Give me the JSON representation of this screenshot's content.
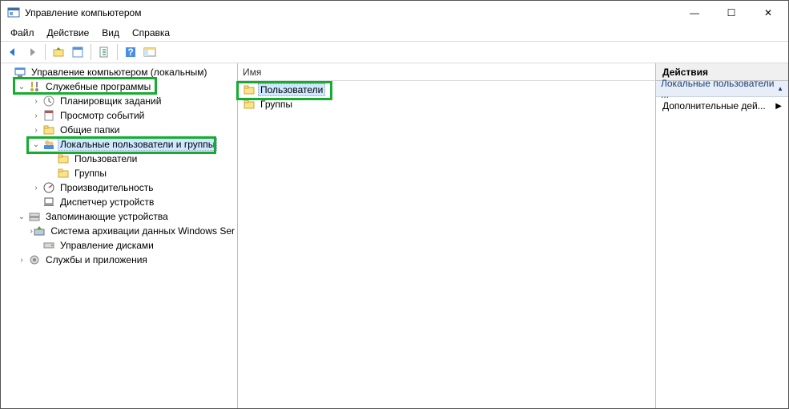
{
  "window": {
    "title": "Управление компьютером",
    "buttons": {
      "min": "—",
      "max": "☐",
      "close": "✕"
    }
  },
  "menu": {
    "items": [
      "Файл",
      "Действие",
      "Вид",
      "Справка"
    ]
  },
  "tree": {
    "root": "Управление компьютером (локальным)",
    "nodes": {
      "sys_tools": "Служебные программы",
      "scheduler": "Планировщик заданий",
      "eventvwr": "Просмотр событий",
      "shared": "Общие папки",
      "lusrmgr": "Локальные пользователи и группы",
      "users": "Пользователи",
      "groups": "Группы",
      "perf": "Производительность",
      "devmgr": "Диспетчер устройств",
      "storage": "Запоминающие устройства",
      "backup": "Система архивации данных Windows Ser",
      "diskmgmt": "Управление дисками",
      "services": "Службы и приложения"
    }
  },
  "list": {
    "header": "Имя",
    "items": [
      {
        "name": "Пользователи",
        "highlighted": true,
        "selected": true
      },
      {
        "name": "Группы",
        "highlighted": false,
        "selected": false
      }
    ]
  },
  "actions": {
    "header": "Действия",
    "section": "Локальные пользователи ...",
    "more": "Дополнительные дей..."
  }
}
